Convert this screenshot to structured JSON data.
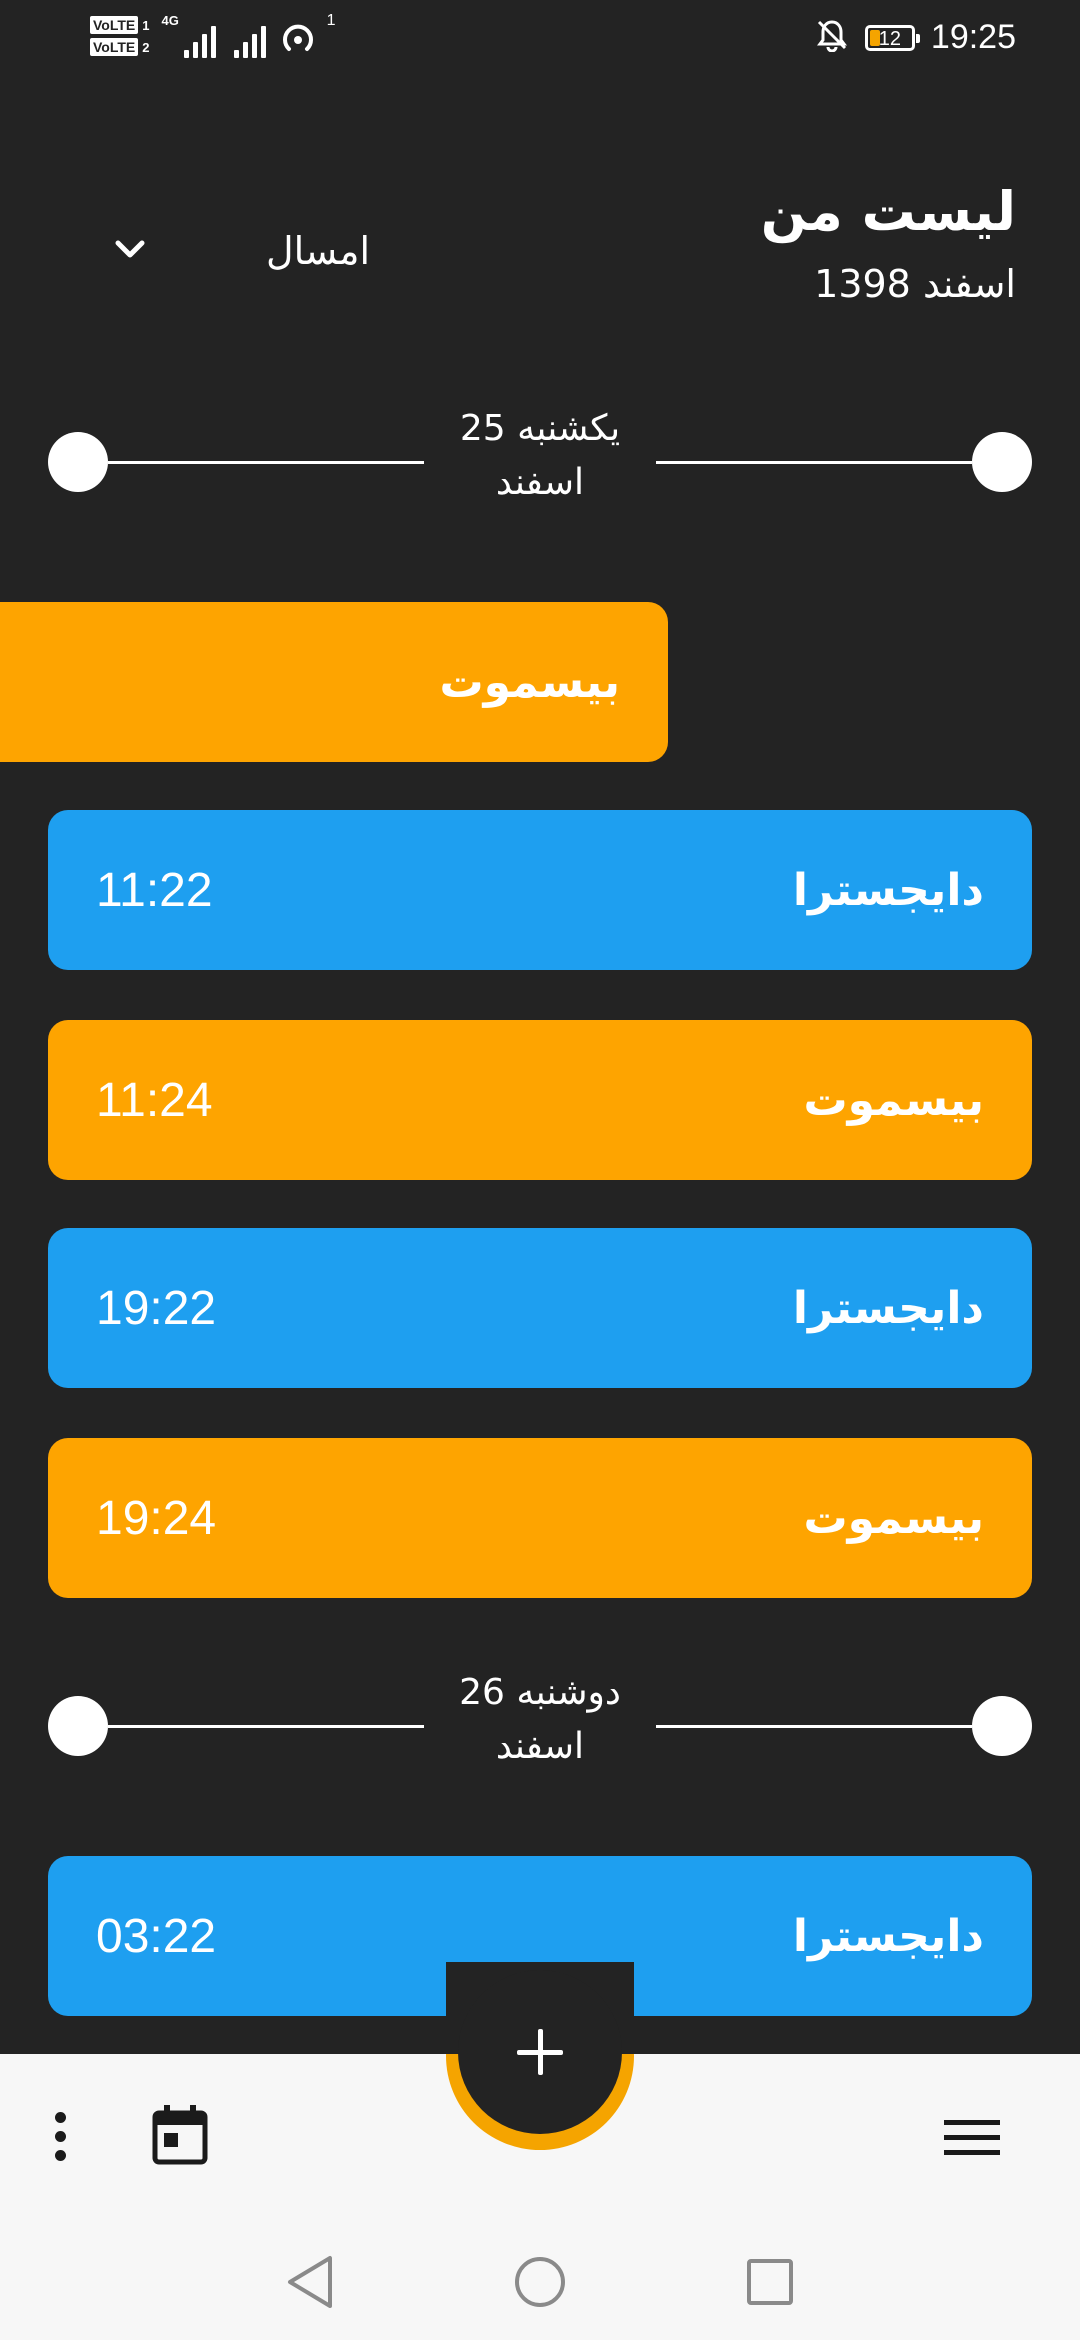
{
  "status_bar": {
    "volte_1": "VoLTE",
    "volte_1_num": "1",
    "volte_2": "VoLTE",
    "volte_2_num": "2",
    "network": "4G",
    "hotspot_count": "1",
    "battery": "12",
    "time": "19:25"
  },
  "header": {
    "title": "لیست من",
    "subtitle": "اسفند 1398",
    "year_filter": "امسال"
  },
  "sections": [
    {
      "date_line1": "یکشنبه 25",
      "date_line2": "اسفند",
      "entries": [
        {
          "name": "بیسموت",
          "time": "",
          "color": "#fea400",
          "partial": true
        },
        {
          "name": "دایجسترا",
          "time": "11:22",
          "color": "#1e9ff0"
        },
        {
          "name": "بیسموت",
          "time": "11:24",
          "color": "#fea400"
        },
        {
          "name": "دایجسترا",
          "time": "19:22",
          "color": "#1e9ff0"
        },
        {
          "name": "بیسموت",
          "time": "19:24",
          "color": "#fea400"
        }
      ]
    },
    {
      "date_line1": "دوشنبه 26",
      "date_line2": "اسفند",
      "entries": [
        {
          "name": "دایجسترا",
          "time": "03:22",
          "color": "#1e9ff0"
        }
      ]
    }
  ],
  "bottom_bar": {
    "fab_icon": "plus-icon",
    "left_icons": [
      "more-vert-icon",
      "calendar-icon"
    ],
    "right_icon": "menu-icon"
  },
  "system_nav": {
    "icons": [
      "back-icon",
      "home-icon",
      "recents-icon"
    ]
  },
  "colors": {
    "background": "#232323",
    "blue": "#1e9ff0",
    "orange": "#fea400",
    "bar": "#f7f7f7"
  }
}
